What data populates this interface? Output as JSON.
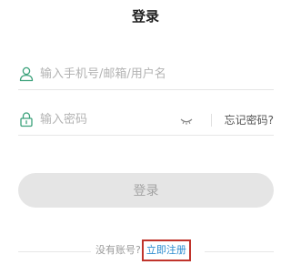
{
  "title": "登录",
  "account": {
    "icon": "user-icon",
    "placeholder": "输入手机号/邮箱/用户名",
    "value": ""
  },
  "password": {
    "icon": "lock-icon",
    "placeholder": "输入密码",
    "value": "",
    "toggle_icon": "eye-closed-icon",
    "forgot_label": "忘记密码?"
  },
  "login_button": {
    "label": "登录"
  },
  "signup": {
    "prompt": "没有账号?",
    "link_label": "立即注册"
  },
  "colors": {
    "icon_green": "#3aa17a",
    "link_blue": "#2a8bd0",
    "highlight_red": "#c0342c",
    "button_bg": "#e5e5e5"
  }
}
